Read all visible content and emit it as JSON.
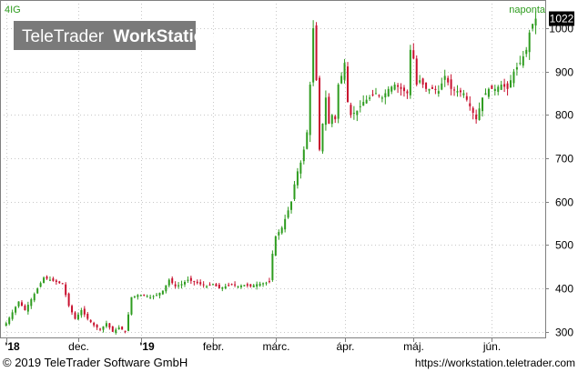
{
  "chart_data": {
    "type": "candlestick",
    "symbol": "4IG",
    "interval": "naponta",
    "last_price": "1022",
    "ylim": [
      285,
      1065
    ],
    "y_ticks": [
      300,
      400,
      500,
      600,
      700,
      800,
      900,
      1000
    ],
    "x_ticks": [
      {
        "label": "'18",
        "t": 0
      },
      {
        "label": "dec.",
        "t": 23
      },
      {
        "label": "'19",
        "t": 43
      },
      {
        "label": "febr.",
        "t": 66
      },
      {
        "label": "márc.",
        "t": 86
      },
      {
        "label": "ápr.",
        "t": 108
      },
      {
        "label": "máj.",
        "t": 130
      },
      {
        "label": "jún.",
        "t": 155
      }
    ],
    "t_range": [
      -0.8,
      170
    ],
    "anchors": [
      [
        0,
        320
      ],
      [
        2,
        345
      ],
      [
        4,
        370
      ],
      [
        6,
        350
      ],
      [
        8,
        375
      ],
      [
        10,
        400
      ],
      [
        12,
        425
      ],
      [
        14,
        420
      ],
      [
        16,
        415
      ],
      [
        18,
        410
      ],
      [
        20,
        360
      ],
      [
        22,
        330
      ],
      [
        24,
        350
      ],
      [
        26,
        330
      ],
      [
        28,
        315
      ],
      [
        30,
        305
      ],
      [
        32,
        320
      ],
      [
        34,
        300
      ],
      [
        36,
        310
      ],
      [
        38,
        300
      ],
      [
        40,
        380
      ],
      [
        42,
        385
      ],
      [
        44,
        385
      ],
      [
        46,
        380
      ],
      [
        48,
        385
      ],
      [
        50,
        395
      ],
      [
        52,
        420
      ],
      [
        54,
        405
      ],
      [
        56,
        410
      ],
      [
        58,
        420
      ],
      [
        60,
        415
      ],
      [
        62,
        410
      ],
      [
        64,
        405
      ],
      [
        66,
        410
      ],
      [
        68,
        400
      ],
      [
        70,
        405
      ],
      [
        72,
        410
      ],
      [
        74,
        405
      ],
      [
        76,
        408
      ],
      [
        78,
        405
      ],
      [
        80,
        410
      ],
      [
        82,
        412
      ],
      [
        84,
        415
      ],
      [
        85,
        480
      ],
      [
        86,
        520
      ],
      [
        87,
        530
      ],
      [
        88,
        540
      ],
      [
        89,
        560
      ],
      [
        90,
        580
      ],
      [
        91,
        600
      ],
      [
        92,
        640
      ],
      [
        93,
        670
      ],
      [
        94,
        690
      ],
      [
        95,
        720
      ],
      [
        96,
        760
      ],
      [
        97,
        870
      ],
      [
        98,
        1000
      ],
      [
        99,
        880
      ],
      [
        100,
        720
      ],
      [
        101,
        780
      ],
      [
        102,
        840
      ],
      [
        103,
        780
      ],
      [
        104,
        800
      ],
      [
        105,
        790
      ],
      [
        106,
        870
      ],
      [
        107,
        890
      ],
      [
        108,
        920
      ],
      [
        109,
        830
      ],
      [
        110,
        800
      ],
      [
        112,
        810
      ],
      [
        114,
        830
      ],
      [
        116,
        840
      ],
      [
        118,
        850
      ],
      [
        120,
        840
      ],
      [
        122,
        860
      ],
      [
        124,
        870
      ],
      [
        126,
        860
      ],
      [
        128,
        850
      ],
      [
        129,
        950
      ],
      [
        130,
        930
      ],
      [
        131,
        870
      ],
      [
        132,
        880
      ],
      [
        134,
        860
      ],
      [
        136,
        860
      ],
      [
        138,
        855
      ],
      [
        140,
        890
      ],
      [
        142,
        860
      ],
      [
        144,
        855
      ],
      [
        146,
        850
      ],
      [
        148,
        820
      ],
      [
        150,
        790
      ],
      [
        152,
        840
      ],
      [
        154,
        860
      ],
      [
        156,
        860
      ],
      [
        158,
        870
      ],
      [
        160,
        860
      ],
      [
        162,
        900
      ],
      [
        164,
        920
      ],
      [
        166,
        950
      ],
      [
        167,
        990
      ],
      [
        168,
        1010
      ],
      [
        169,
        1022
      ]
    ]
  },
  "branding": {
    "watermark_light": "TeleTrader",
    "watermark_bold": "WorkStation"
  },
  "footer": {
    "copyright": "© 2019 TeleTrader Software GmbH",
    "url": "https://workstation.teletrader.com"
  },
  "colors": {
    "up": "#2e9c1f",
    "down": "#c8102e",
    "grid": "#c8c8c8",
    "symbol_text": "#2e9c1f",
    "interval_text": "#2e9c1f",
    "watermark_bg": "#7a7a7a",
    "last_price_bg": "#000000"
  }
}
